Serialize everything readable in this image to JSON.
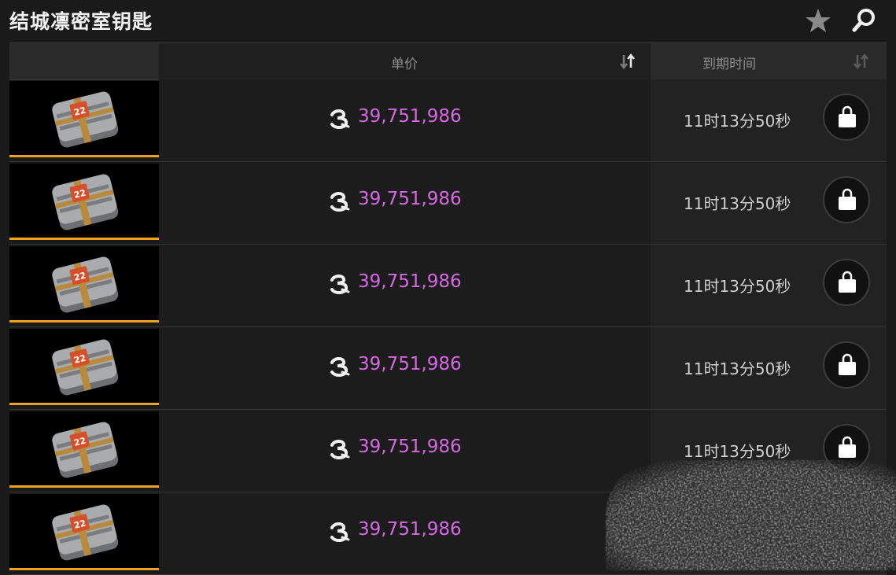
{
  "header": {
    "title": "结城凛密室钥匙"
  },
  "table": {
    "columns": {
      "price": "单价",
      "expiry": "到期时间"
    },
    "rows": [
      {
        "price": "39,751,986",
        "expiry": "11时13分50秒"
      },
      {
        "price": "39,751,986",
        "expiry": "11时13分50秒"
      },
      {
        "price": "39,751,986",
        "expiry": "11时13分50秒"
      },
      {
        "price": "39,751,986",
        "expiry": "11时13分50秒"
      },
      {
        "price": "39,751,986",
        "expiry": "11时13分50秒"
      },
      {
        "price": "39,751,986",
        "expiry": ""
      }
    ]
  },
  "icons": {
    "favorite": "star-icon",
    "search": "search-icon",
    "sort": "sort-icon",
    "currency": "currency-icon",
    "buy": "shopping-bag-icon",
    "item": "key-box-icon"
  },
  "colors": {
    "price": "#d768e3",
    "rarity_bar": "#f0a21e",
    "background": "#1a1a1b"
  }
}
